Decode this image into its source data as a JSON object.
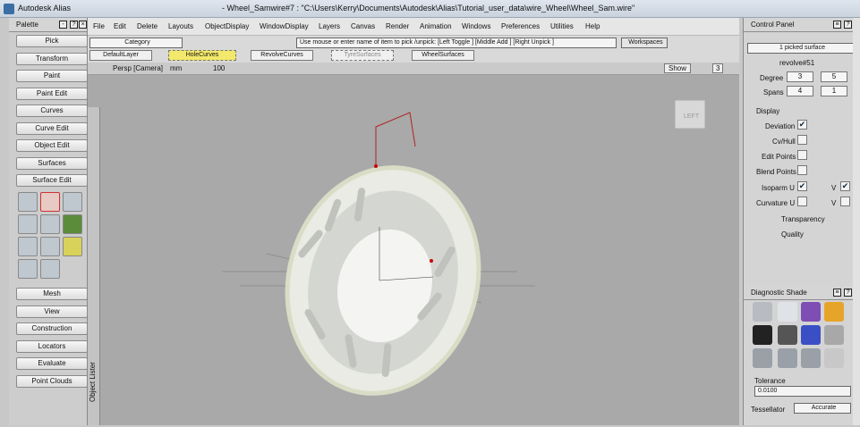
{
  "titlebar": {
    "app": "Autodesk Alias",
    "doc": "- Wheel_Samwire#7 : \"C:\\Users\\Kerry\\Documents\\Autodesk\\Alias\\Tutorial_user_data\\wire_Wheel\\Wheel_Sam.wire\""
  },
  "palette": {
    "title": "Palette",
    "buttons": [
      "Pick",
      "Transform",
      "Paint",
      "Paint Edit",
      "Curves",
      "Curve Edit",
      "Object Edit",
      "Surfaces",
      "Surface Edit"
    ],
    "buttons2": [
      "Mesh",
      "View",
      "Construction",
      "Locators",
      "Evaluate",
      "Point Clouds"
    ]
  },
  "menu": [
    "File",
    "Edit",
    "Delete",
    "Layouts",
    "ObjectDisplay",
    "WindowDisplay",
    "Layers",
    "Canvas",
    "Render",
    "Animation",
    "Windows",
    "Preferences",
    "Utilities",
    "Help"
  ],
  "shelf": {
    "category": "Category",
    "prompt": "Use mouse or enter name of item to pick /unpick: [Left Toggle ] [Middle Add ] [Right Unpick ]",
    "workspaces": "Workspaces"
  },
  "layers": [
    "DefaultLayer",
    "HoleCurves",
    "RevolveCurves",
    "TyreSurfaces",
    "WheelSurfaces"
  ],
  "view": {
    "camera": "Persp [Camera]",
    "mm": "mm",
    "value": "100",
    "show": "Show",
    "num": "3",
    "cube": "LEFT"
  },
  "lister": {
    "label": "Object Lister"
  },
  "control": {
    "title": "Control Panel",
    "picked": "1 picked surface",
    "name": "revolve#51",
    "degree_label": "Degree",
    "degree": [
      "3",
      "5"
    ],
    "spans_label": "Spans",
    "spans": [
      "4",
      "1"
    ],
    "display": "Display",
    "rows": [
      "Deviation",
      "Cv/Hull",
      "Edit Points",
      "Blend Points",
      "Isoparm U",
      "Curvature U"
    ],
    "v_label": "V",
    "transparency": "Transparency",
    "quality": "Quality"
  },
  "diag": {
    "title": "Diagnostic Shade",
    "tolerance_label": "Tolerance",
    "tolerance": "0.0100",
    "tess_label": "Tessellator",
    "tess": "Accurate"
  }
}
